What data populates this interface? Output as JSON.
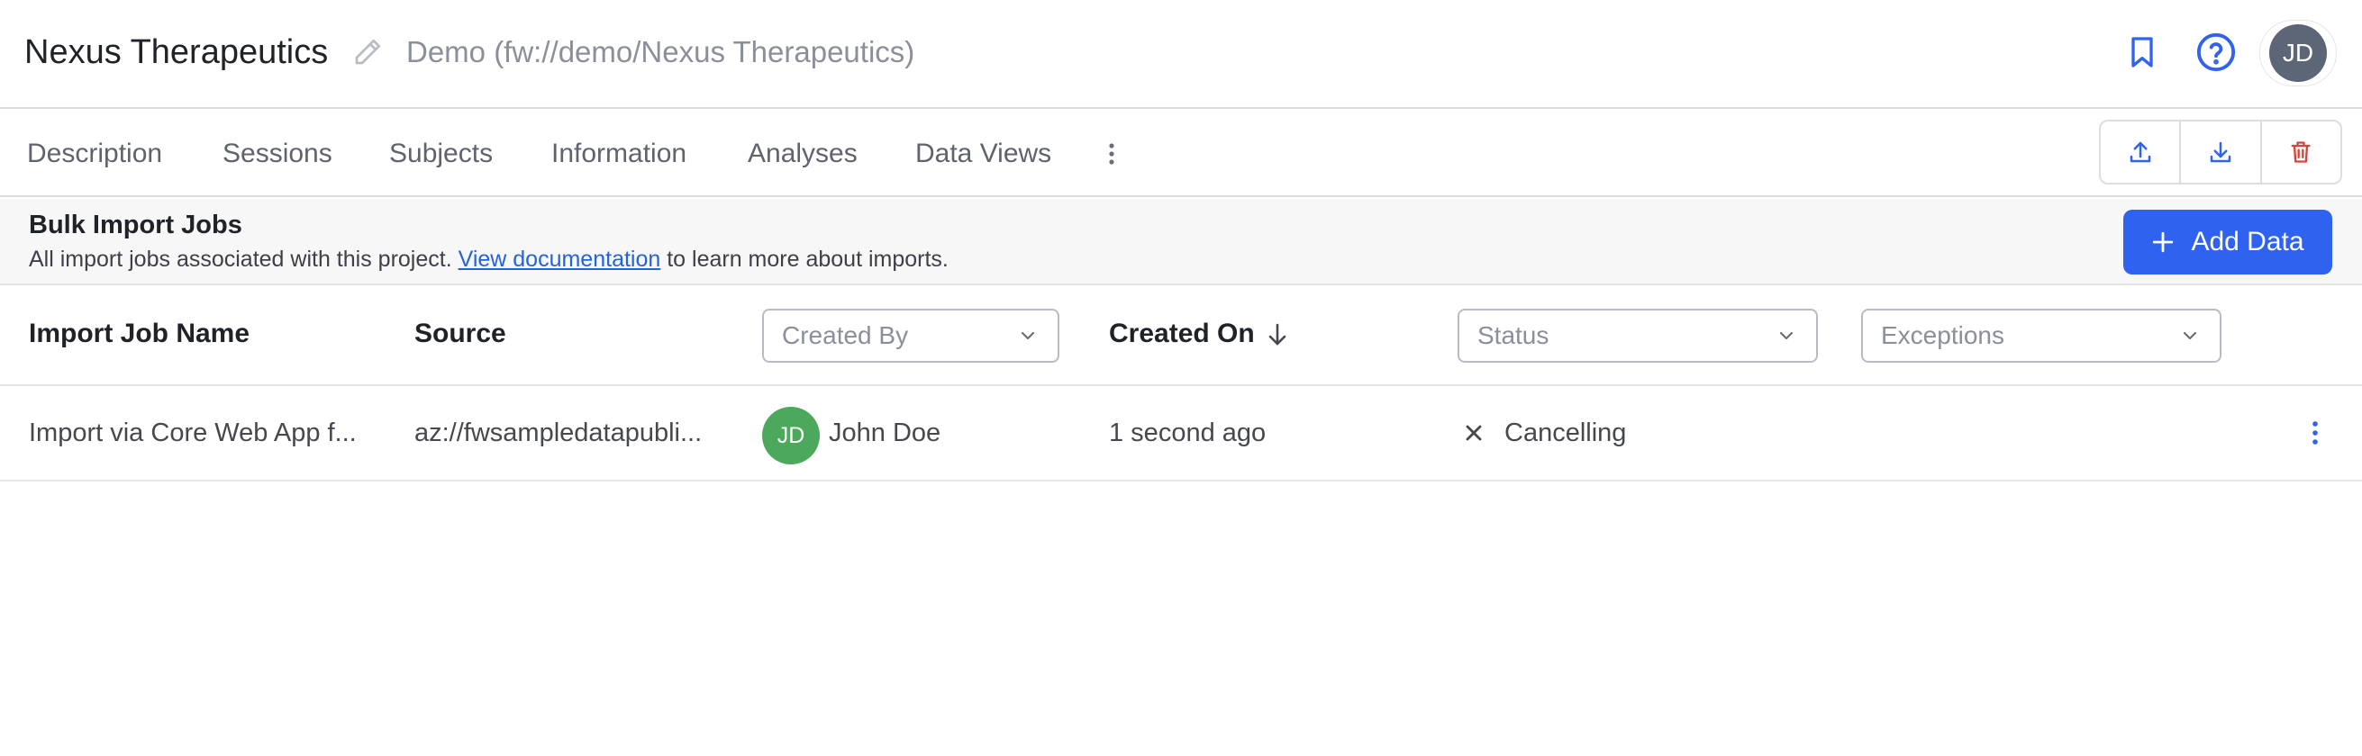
{
  "header": {
    "project_title": "Nexus Therapeutics",
    "project_path": "Demo (fw://demo/Nexus Therapeutics)",
    "user_initials": "JD",
    "icons": {
      "edit": "pencil-icon",
      "bookmark": "bookmark-icon",
      "help": "help-circle-icon"
    }
  },
  "tabs": [
    {
      "label": "Description"
    },
    {
      "label": "Sessions"
    },
    {
      "label": "Subjects"
    },
    {
      "label": "Information"
    },
    {
      "label": "Analyses"
    },
    {
      "label": "Data Views"
    }
  ],
  "toolbar": {
    "icons": {
      "upload": "upload-icon",
      "download": "download-icon",
      "delete": "trash-icon"
    },
    "delete_color": "#d9433a"
  },
  "section": {
    "title": "Bulk Import Jobs",
    "desc_before": "All import jobs associated with this project. ",
    "doc_link": "View documentation",
    "desc_after": " to learn more about imports.",
    "add_button": "Add Data"
  },
  "table": {
    "columns": {
      "name": "Import Job Name",
      "source": "Source",
      "created_by": "Created By",
      "created_on": "Created On",
      "status": "Status",
      "exceptions": "Exceptions"
    },
    "rows": [
      {
        "name": "Import via Core Web App f...",
        "source": "az://fwsampledatapubli...",
        "user_initials": "JD",
        "user_name": "John Doe",
        "created_on": "1 second ago",
        "status": "Cancelling"
      }
    ]
  },
  "colors": {
    "accent": "#2f62ef",
    "user_avatar": "#4ca85a",
    "header_avatar": "#5d6676"
  }
}
